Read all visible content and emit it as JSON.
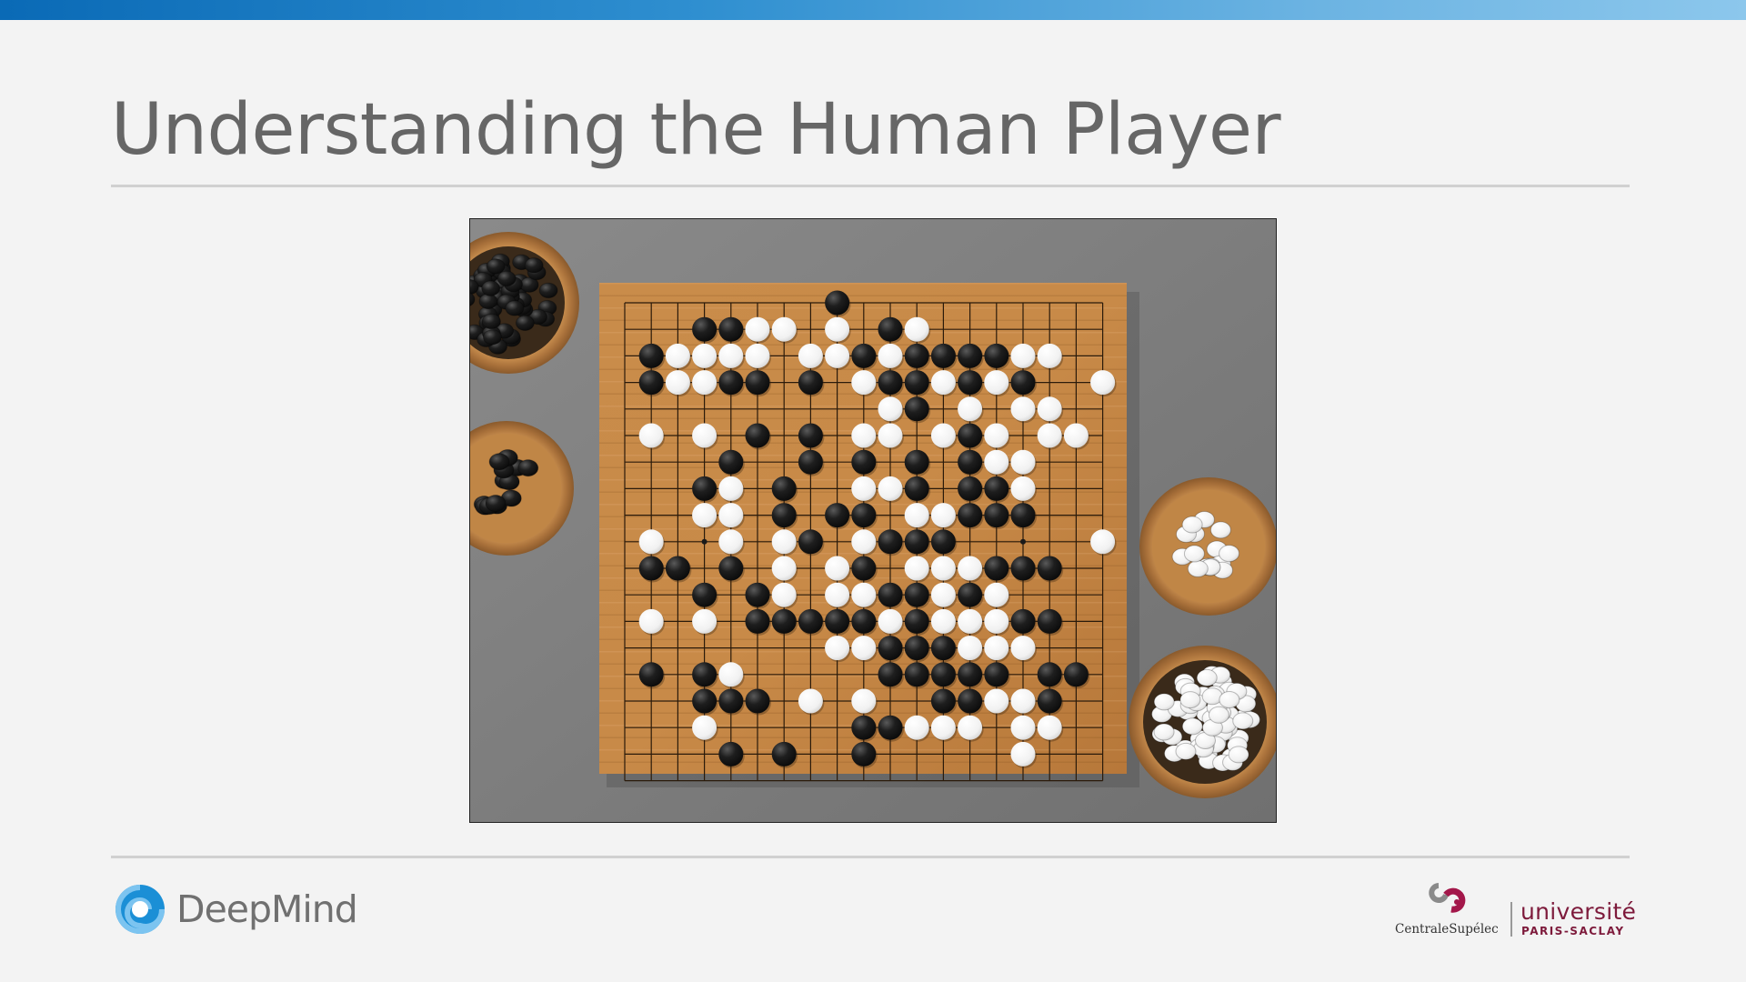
{
  "slide": {
    "title": "Understanding the Human Player"
  },
  "image": {
    "description_icon": "go-board-photo-icon"
  },
  "footer": {
    "left_logo_text": "DeepMind",
    "right_logo_1_text": "CentraleSupélec",
    "right_logo_2_text": "université",
    "right_logo_2_sub": "PARIS-SACLAY"
  },
  "colors": {
    "title": "#666666",
    "top_bar_start": "#0a6ab6",
    "top_bar_end": "#8cc7ec",
    "deepmind_blue": "#1b8fd6",
    "ups_burgundy": "#7d1a3b"
  }
}
